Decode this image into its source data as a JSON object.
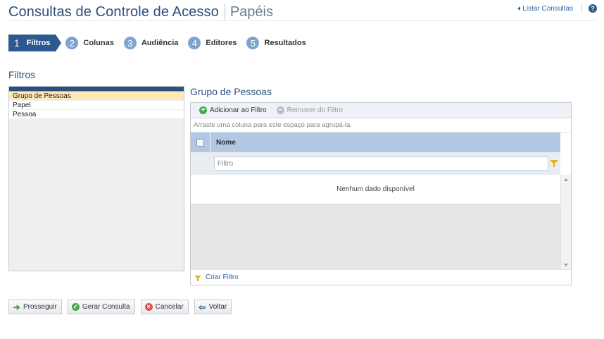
{
  "header": {
    "title": "Consultas de Controle de Acesso",
    "subtitle": "Papéis",
    "list_link": "Listar Consultas",
    "help_glyph": "?"
  },
  "wizard": {
    "steps": [
      {
        "num": "1",
        "label": "Filtros",
        "active": true
      },
      {
        "num": "2",
        "label": "Colunas",
        "active": false
      },
      {
        "num": "3",
        "label": "Audiência",
        "active": false
      },
      {
        "num": "4",
        "label": "Editores",
        "active": false
      },
      {
        "num": "5",
        "label": "Resultados",
        "active": false
      }
    ]
  },
  "filters": {
    "title": "Filtros",
    "items": [
      "Grupo de Pessoas",
      "Papel",
      "Pessoa"
    ],
    "selected": "Grupo de Pessoas"
  },
  "group_panel": {
    "title": "Grupo de Pessoas",
    "toolbar": {
      "add_label": "Adicionar ao Filtro",
      "remove_label": "Remover do Filtro"
    },
    "group_hint": "Arraste uma coluna para este espaço para agrupá-la.",
    "column_name": "Nome",
    "filter_placeholder": "Filtro",
    "no_data": "Nenhum dado disponível",
    "create_filter": "Criar Filtro"
  },
  "actions": {
    "proceed": "Prosseguir",
    "generate": "Gerar Consulta",
    "cancel": "Cancelar",
    "back": "Voltar"
  },
  "colors": {
    "brand": "#2d4f7c",
    "step_active": "#2d5a8e",
    "step_inactive": "#7fa3cc",
    "selection": "#fce9b4",
    "grid_header": "#b1c7e2"
  }
}
